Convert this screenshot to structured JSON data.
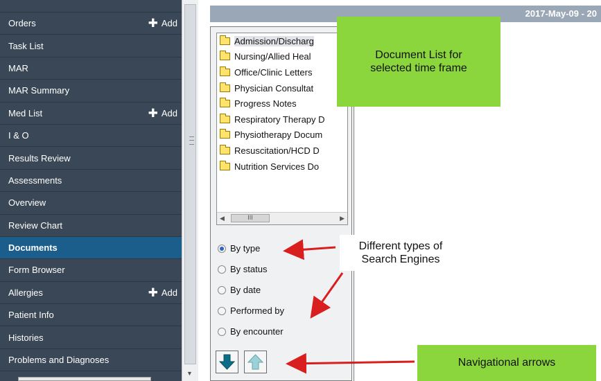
{
  "header": {
    "date_text": "2017-May-09 - 20"
  },
  "sidebar": {
    "items": [
      {
        "label": "Orders",
        "add": "Add",
        "active": false
      },
      {
        "label": "Task List",
        "add": "",
        "active": false
      },
      {
        "label": "MAR",
        "add": "",
        "active": false
      },
      {
        "label": "MAR Summary",
        "add": "",
        "active": false
      },
      {
        "label": "Med List",
        "add": "Add",
        "active": false
      },
      {
        "label": "I & O",
        "add": "",
        "active": false
      },
      {
        "label": "Results Review",
        "add": "",
        "active": false
      },
      {
        "label": "Assessments",
        "add": "",
        "active": false
      },
      {
        "label": "Overview",
        "add": "",
        "active": false
      },
      {
        "label": "Review Chart",
        "add": "",
        "active": false
      },
      {
        "label": "Documents",
        "add": "",
        "active": true
      },
      {
        "label": "Form Browser",
        "add": "",
        "active": false
      },
      {
        "label": "Allergies",
        "add": "Add",
        "active": false
      },
      {
        "label": "Patient Info",
        "add": "",
        "active": false
      },
      {
        "label": "Histories",
        "add": "",
        "active": false
      },
      {
        "label": "Problems and Diagnoses",
        "add": "",
        "active": false
      }
    ]
  },
  "document_tree": {
    "folders": [
      "Admission/Discharg",
      "Nursing/Allied Heal",
      "Office/Clinic Letters",
      "Physician Consultat",
      "Progress Notes",
      "Respiratory Therapy D",
      "Physiotherapy Docum",
      "Resuscitation/HCD D",
      "Nutrition Services Do"
    ],
    "selected_index": 0
  },
  "search_options": {
    "selected": "By type",
    "options": [
      "By type",
      "By status",
      "By date",
      "Performed by",
      "By encounter"
    ]
  },
  "callouts": {
    "doc_list": "Document List for selected time frame",
    "search": "Different types of Search  Engines",
    "nav": "Navigational arrows"
  },
  "colors": {
    "sidebar_bg": "#3a4756",
    "active_item": "#1b5e8c",
    "callout_green": "#8bd53d",
    "annotation_arrow": "#d81e1e",
    "nav_down_arrow": "#0b6e87",
    "nav_up_arrow": "#9bd2d8"
  },
  "icons": {
    "add": "plus-icon",
    "folder": "folder-icon",
    "down": "arrow-down-icon",
    "up": "arrow-up-icon"
  }
}
